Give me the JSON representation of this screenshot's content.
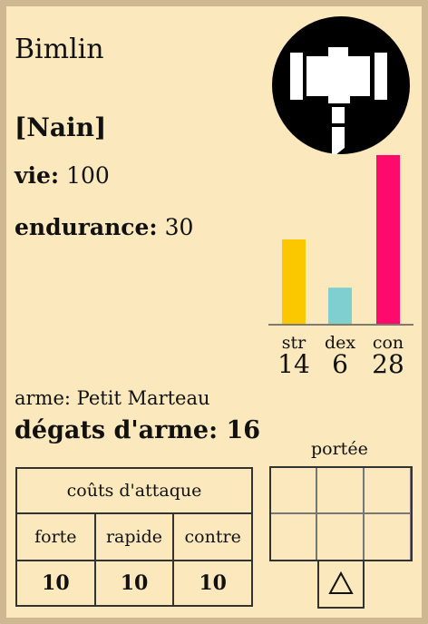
{
  "character": {
    "name": "Bimlin",
    "race": "[Nain]",
    "vie_label": "vie:",
    "vie_value": "100",
    "endurance_label": "endurance:",
    "endurance_value": "30",
    "emblem_icon": "hammer-icon"
  },
  "chart_data": {
    "type": "bar",
    "categories": [
      "str",
      "dex",
      "con"
    ],
    "values": [
      14,
      6,
      28
    ],
    "value_labels": [
      "14",
      "6",
      "28"
    ],
    "colors": [
      "#fbc800",
      "#7fcfcf",
      "#fe0a6c"
    ],
    "ylim": [
      0,
      28
    ]
  },
  "weapon": {
    "arme_label": "arme:",
    "arme_name": "Petit Marteau",
    "degats_label": "dégats d'arme:",
    "degats_value": "16"
  },
  "attack_costs": {
    "title": "coûts d'attaque",
    "headers": [
      "forte",
      "rapide",
      "contre"
    ],
    "values": [
      "10",
      "10",
      "10"
    ]
  },
  "range": {
    "label": "portée",
    "origin_icon": "triangle-outline-icon"
  },
  "colors": {
    "background": "#fbe8bc",
    "frame": "#cdb892"
  }
}
